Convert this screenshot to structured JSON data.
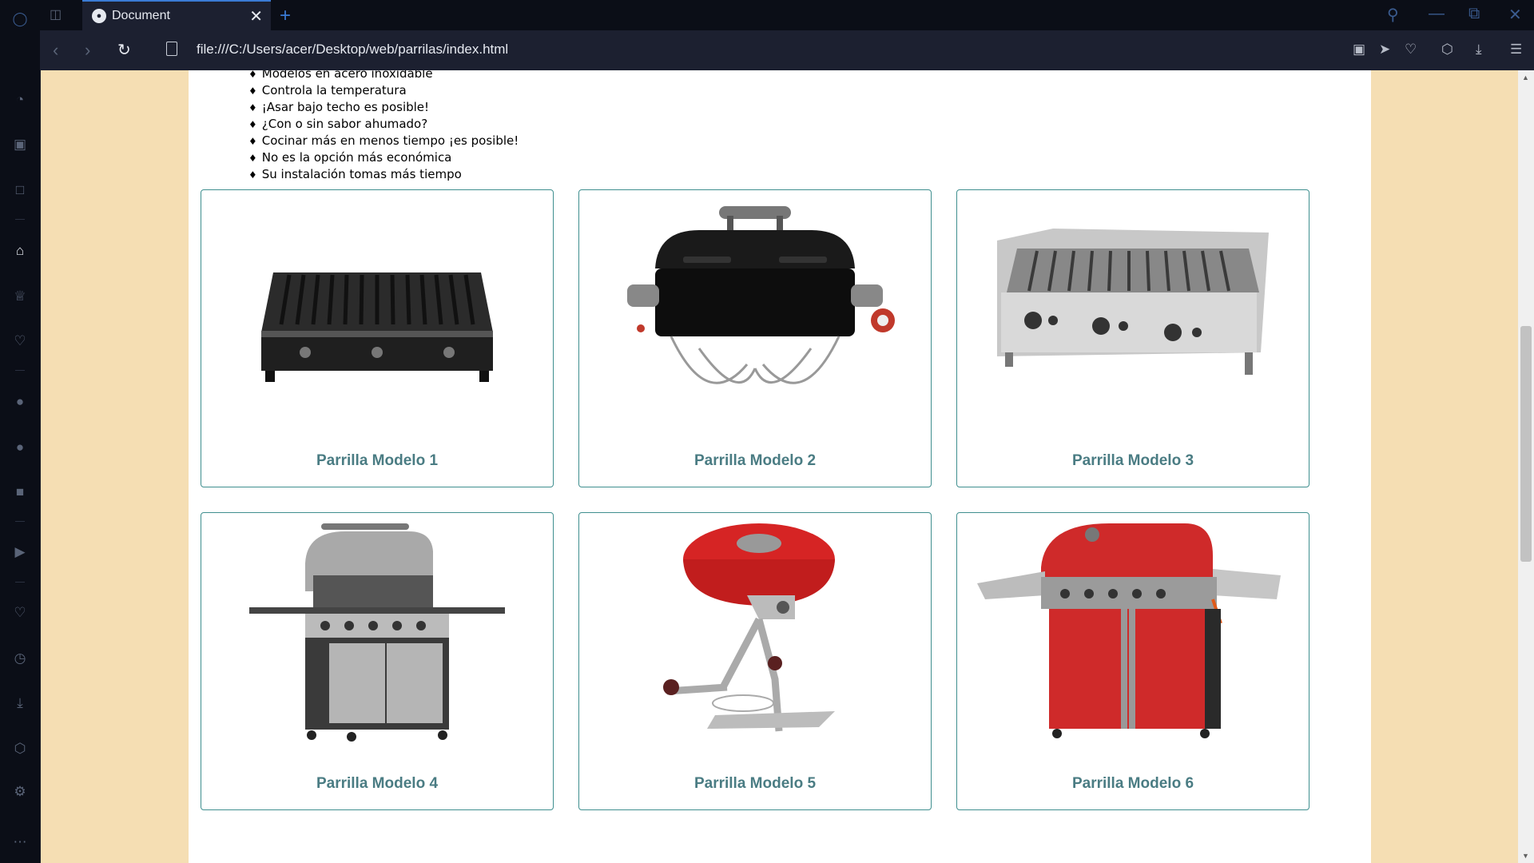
{
  "browser": {
    "tab_title": "Document",
    "tab_favicon": "globe-icon",
    "url": "file:///C:/Users/acer/Desktop/web/parrilas/index.html"
  },
  "page": {
    "features": [
      "Modelos en acero inoxidable",
      "Controla la temperatura",
      "¡Asar bajo techo es posible!",
      "¿Con o sin sabor ahumado?",
      "Cocinar más en menos tiempo ¡es posible!",
      "No es la opción más económica",
      "Su instalación tomas más tiempo"
    ],
    "cards": [
      {
        "label": "Parrilla Modelo 1"
      },
      {
        "label": "Parrilla Modelo 2"
      },
      {
        "label": "Parrilla Modelo 3"
      },
      {
        "label": "Parrilla Modelo 4"
      },
      {
        "label": "Parrilla Modelo 5"
      },
      {
        "label": "Parrilla Modelo 6"
      }
    ]
  },
  "colors": {
    "page_background": "#f5deb3",
    "card_border": "#3f8f8f",
    "card_label": "#4a7c83",
    "accent": "#3a7bd5"
  }
}
